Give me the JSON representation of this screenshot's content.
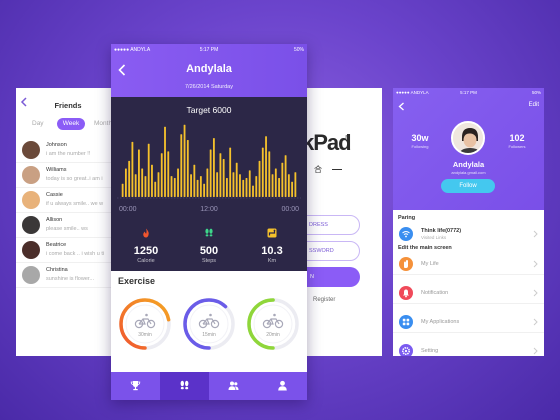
{
  "friends_screen": {
    "title": "Friends",
    "segments": [
      "Day",
      "Week",
      "Month"
    ],
    "items": [
      {
        "name": "Johnson",
        "message": "i am the number !!",
        "avatar_color": "#6b4a3a"
      },
      {
        "name": "Williams",
        "message": "today is so great..i am i",
        "avatar_color": "#c9a083"
      },
      {
        "name": "Cassie",
        "message": "if u always smile.. we w",
        "avatar_color": "#e8b27a"
      },
      {
        "name": "Allison",
        "message": "please smile.. ws",
        "avatar_color": "#3b3838"
      },
      {
        "name": "Beatrice",
        "message": "i come back .. i wish u ti",
        "avatar_color": "#4b2e2a"
      },
      {
        "name": "Christina",
        "message": "sunshine is flower...",
        "avatar_color": "#a8a8a8"
      }
    ]
  },
  "login_screen": {
    "logo": "kPad",
    "logo_mark": "®",
    "sub": "合",
    "email_placeholder": "DRESS",
    "password_placeholder": "SSWORD",
    "button": "N",
    "register": "Register"
  },
  "main_screen": {
    "status": {
      "carrier": "●●●●● ANDYLA",
      "time": "5:17 PM",
      "battery": "50%"
    },
    "title": "Andylala",
    "date": "7/26/2014  Saturday",
    "target": "Target 6000",
    "chart_data": {
      "type": "bar",
      "x_ticks": [
        "00:00",
        "12:00",
        "00:00"
      ],
      "values": [
        14,
        30,
        38,
        58,
        24,
        50,
        30,
        22,
        56,
        34,
        16,
        26,
        46,
        74,
        48,
        22,
        20,
        30,
        66,
        76,
        60,
        24,
        34,
        18,
        22,
        14,
        30,
        50,
        62,
        26,
        46,
        40,
        20,
        52,
        26,
        36,
        24,
        18,
        20,
        28,
        12,
        22,
        38,
        52,
        64,
        48,
        24,
        30,
        20,
        36,
        44,
        24,
        16,
        26
      ],
      "bar_color": "#f5c12c"
    },
    "stats": [
      {
        "value": "1250",
        "label": "Calorie",
        "icon": "flame-icon",
        "color": "#f0562f"
      },
      {
        "value": "500",
        "label": "Steps",
        "icon": "footsteps-icon",
        "color": "#3dd68a"
      },
      {
        "value": "10.3",
        "label": "Km",
        "icon": "route-icon",
        "color": "#f5c12c"
      }
    ],
    "exercise_title": "Exercise",
    "rings": [
      {
        "label": "30min",
        "color": "#f5a623",
        "color2": "#f0562f",
        "progress": 0.72
      },
      {
        "label": "15min",
        "color": "#6a5ce8",
        "color2": "#6a5ce8",
        "progress": 0.62
      },
      {
        "label": "20min",
        "color": "#8fd63a",
        "color2": "#8fd63a",
        "progress": 0.5
      }
    ],
    "tabs": [
      "trophy-icon",
      "footsteps-icon",
      "group-icon",
      "person-icon"
    ]
  },
  "profile_screen": {
    "status": {
      "carrier": "●●●●● ANDYLA",
      "time": "5:17 PM",
      "battery": "50%"
    },
    "edit": "Edit",
    "following_count": "30w",
    "following_label": "Following",
    "followers_count": "102",
    "followers_label": "Followers",
    "name": "Andylala",
    "email": "andylala.gmail.com",
    "follow_button": "Follow",
    "section_pairing": "Paring",
    "pairing_title": "Think life(0772)",
    "pairing_sub": "Visited Links",
    "section_edit": "Edit the main screen",
    "menu": [
      {
        "label": "My Life",
        "color": "#f5913a",
        "icon": "hand-icon"
      },
      {
        "label": "Notification",
        "color": "#f04a5a",
        "icon": "bell-icon"
      },
      {
        "label": "My Applications",
        "color": "#3a8ef0",
        "icon": "grid-icon"
      },
      {
        "label": "Setting",
        "color": "#7a5af0",
        "icon": "gear-icon"
      }
    ]
  }
}
